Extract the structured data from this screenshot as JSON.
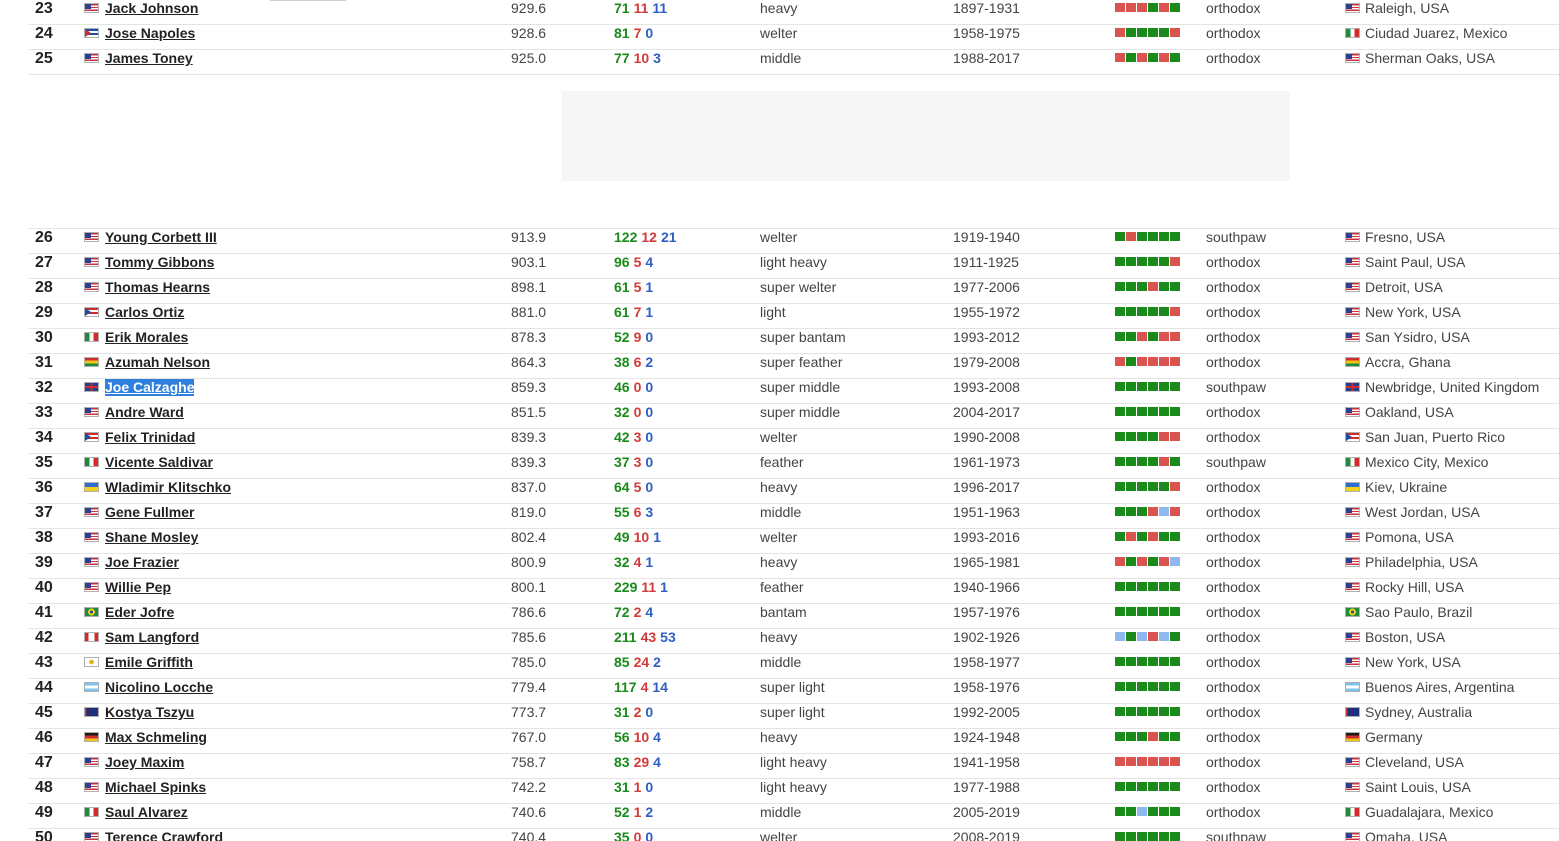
{
  "colors": {
    "win": "#1a8a1a",
    "loss": "#d13b3b",
    "draw": "#2f5fc4",
    "form_win": "#1a8a1a",
    "form_loss": "#d9534f",
    "form_draw": "#8fb8ef"
  },
  "rows_top": [
    {
      "rank": "23",
      "name": "Jack Johnson",
      "flag": "us-flag-icon",
      "rating": "929.6",
      "w": "71",
      "l": "11",
      "d": "11",
      "division": "heavy",
      "years": "1897-1931",
      "form": [
        "L",
        "L",
        "L",
        "W",
        "L",
        "W"
      ],
      "stance": "orthodox",
      "res_flag": "us-flag-icon",
      "residence": "Raleigh, USA"
    },
    {
      "rank": "24",
      "name": "Jose Napoles",
      "flag": "cuba-flag-icon",
      "rating": "928.6",
      "w": "81",
      "l": "7",
      "d": "0",
      "division": "welter",
      "years": "1958-1975",
      "form": [
        "L",
        "W",
        "W",
        "W",
        "W",
        "L"
      ],
      "stance": "orthodox",
      "res_flag": "mexico-flag-icon",
      "residence": "Ciudad Juarez, Mexico"
    },
    {
      "rank": "25",
      "name": "James Toney",
      "flag": "us-flag-icon",
      "rating": "925.0",
      "w": "77",
      "l": "10",
      "d": "3",
      "division": "middle",
      "years": "1988-2017",
      "form": [
        "L",
        "W",
        "L",
        "W",
        "L",
        "W"
      ],
      "stance": "orthodox",
      "res_flag": "us-flag-icon",
      "residence": "Sherman Oaks, USA"
    }
  ],
  "rows_bottom": [
    {
      "rank": "26",
      "name": "Young Corbett III",
      "flag": "us-flag-icon",
      "rating": "913.9",
      "w": "122",
      "l": "12",
      "d": "21",
      "division": "welter",
      "years": "1919-1940",
      "form": [
        "W",
        "L",
        "W",
        "W",
        "W",
        "W"
      ],
      "stance": "southpaw",
      "res_flag": "us-flag-icon",
      "residence": "Fresno, USA"
    },
    {
      "rank": "27",
      "name": "Tommy Gibbons",
      "flag": "us-flag-icon",
      "rating": "903.1",
      "w": "96",
      "l": "5",
      "d": "4",
      "division": "light heavy",
      "years": "1911-1925",
      "form": [
        "W",
        "W",
        "W",
        "W",
        "W",
        "L"
      ],
      "stance": "orthodox",
      "res_flag": "us-flag-icon",
      "residence": "Saint Paul, USA"
    },
    {
      "rank": "28",
      "name": "Thomas Hearns",
      "flag": "us-flag-icon",
      "rating": "898.1",
      "w": "61",
      "l": "5",
      "d": "1",
      "division": "super welter",
      "years": "1977-2006",
      "form": [
        "W",
        "W",
        "W",
        "L",
        "W",
        "W"
      ],
      "stance": "orthodox",
      "res_flag": "us-flag-icon",
      "residence": "Detroit, USA"
    },
    {
      "rank": "29",
      "name": "Carlos Ortiz",
      "flag": "puerto-rico-flag-icon",
      "rating": "881.0",
      "w": "61",
      "l": "7",
      "d": "1",
      "division": "light",
      "years": "1955-1972",
      "form": [
        "W",
        "W",
        "W",
        "W",
        "W",
        "L"
      ],
      "stance": "orthodox",
      "res_flag": "us-flag-icon",
      "residence": "New York, USA"
    },
    {
      "rank": "30",
      "name": "Erik Morales",
      "flag": "mexico-flag-icon",
      "rating": "878.3",
      "w": "52",
      "l": "9",
      "d": "0",
      "division": "super bantam",
      "years": "1993-2012",
      "form": [
        "W",
        "W",
        "L",
        "W",
        "L",
        "L"
      ],
      "stance": "orthodox",
      "res_flag": "us-flag-icon",
      "residence": "San Ysidro, USA"
    },
    {
      "rank": "31",
      "name": "Azumah Nelson",
      "flag": "ghana-flag-icon",
      "rating": "864.3",
      "w": "38",
      "l": "6",
      "d": "2",
      "division": "super feather",
      "years": "1979-2008",
      "form": [
        "L",
        "W",
        "L",
        "L",
        "L",
        "L"
      ],
      "stance": "orthodox",
      "res_flag": "ghana-flag-icon",
      "residence": "Accra, Ghana"
    },
    {
      "rank": "32",
      "name": "Joe Calzaghe",
      "flag": "uk-flag-icon",
      "rating": "859.3",
      "w": "46",
      "l": "0",
      "d": "0",
      "division": "super middle",
      "years": "1993-2008",
      "form": [
        "W",
        "W",
        "W",
        "W",
        "W",
        "W"
      ],
      "stance": "southpaw",
      "res_flag": "uk-flag-icon",
      "residence": "Newbridge, United Kingdom",
      "selected": true
    },
    {
      "rank": "33",
      "name": "Andre Ward",
      "flag": "us-flag-icon",
      "rating": "851.5",
      "w": "32",
      "l": "0",
      "d": "0",
      "division": "super middle",
      "years": "2004-2017",
      "form": [
        "W",
        "W",
        "W",
        "W",
        "W",
        "W"
      ],
      "stance": "orthodox",
      "res_flag": "us-flag-icon",
      "residence": "Oakland, USA"
    },
    {
      "rank": "34",
      "name": "Felix Trinidad",
      "flag": "puerto-rico-flag-icon",
      "rating": "839.3",
      "w": "42",
      "l": "3",
      "d": "0",
      "division": "welter",
      "years": "1990-2008",
      "form": [
        "W",
        "W",
        "W",
        "W",
        "L",
        "L"
      ],
      "stance": "orthodox",
      "res_flag": "puerto-rico-flag-icon",
      "residence": "San Juan, Puerto Rico"
    },
    {
      "rank": "35",
      "name": "Vicente Saldivar",
      "flag": "mexico-flag-icon",
      "rating": "839.3",
      "w": "37",
      "l": "3",
      "d": "0",
      "division": "feather",
      "years": "1961-1973",
      "form": [
        "W",
        "W",
        "W",
        "W",
        "L",
        "W"
      ],
      "stance": "southpaw",
      "res_flag": "mexico-flag-icon",
      "residence": "Mexico City, Mexico"
    },
    {
      "rank": "36",
      "name": "Wladimir Klitschko",
      "flag": "ukraine-flag-icon",
      "rating": "837.0",
      "w": "64",
      "l": "5",
      "d": "0",
      "division": "heavy",
      "years": "1996-2017",
      "form": [
        "W",
        "W",
        "W",
        "W",
        "W",
        "L"
      ],
      "stance": "orthodox",
      "res_flag": "ukraine-flag-icon",
      "residence": "Kiev, Ukraine"
    },
    {
      "rank": "37",
      "name": "Gene Fullmer",
      "flag": "us-flag-icon",
      "rating": "819.0",
      "w": "55",
      "l": "6",
      "d": "3",
      "division": "middle",
      "years": "1951-1963",
      "form": [
        "W",
        "W",
        "W",
        "L",
        "D",
        "L"
      ],
      "stance": "orthodox",
      "res_flag": "us-flag-icon",
      "residence": "West Jordan, USA"
    },
    {
      "rank": "38",
      "name": "Shane Mosley",
      "flag": "us-flag-icon",
      "rating": "802.4",
      "w": "49",
      "l": "10",
      "d": "1",
      "division": "welter",
      "years": "1993-2016",
      "form": [
        "W",
        "L",
        "W",
        "L",
        "W",
        "W"
      ],
      "stance": "orthodox",
      "res_flag": "us-flag-icon",
      "residence": "Pomona, USA"
    },
    {
      "rank": "39",
      "name": "Joe Frazier",
      "flag": "us-flag-icon",
      "rating": "800.9",
      "w": "32",
      "l": "4",
      "d": "1",
      "division": "heavy",
      "years": "1965-1981",
      "form": [
        "L",
        "W",
        "L",
        "W",
        "L",
        "D"
      ],
      "stance": "orthodox",
      "res_flag": "us-flag-icon",
      "residence": "Philadelphia, USA"
    },
    {
      "rank": "40",
      "name": "Willie Pep",
      "flag": "us-flag-icon",
      "rating": "800.1",
      "w": "229",
      "l": "11",
      "d": "1",
      "division": "feather",
      "years": "1940-1966",
      "form": [
        "W",
        "W",
        "W",
        "W",
        "W",
        "W"
      ],
      "stance": "orthodox",
      "res_flag": "us-flag-icon",
      "residence": "Rocky Hill, USA"
    },
    {
      "rank": "41",
      "name": "Eder Jofre",
      "flag": "brazil-flag-icon",
      "rating": "786.6",
      "w": "72",
      "l": "2",
      "d": "4",
      "division": "bantam",
      "years": "1957-1976",
      "form": [
        "W",
        "W",
        "W",
        "W",
        "W",
        "W"
      ],
      "stance": "orthodox",
      "res_flag": "brazil-flag-icon",
      "residence": "Sao Paulo, Brazil"
    },
    {
      "rank": "42",
      "name": "Sam Langford",
      "flag": "canada-flag-icon",
      "rating": "785.6",
      "w": "211",
      "l": "43",
      "d": "53",
      "division": "heavy",
      "years": "1902-1926",
      "form": [
        "D",
        "W",
        "D",
        "L",
        "D",
        "W"
      ],
      "stance": "orthodox",
      "res_flag": "us-flag-icon",
      "residence": "Boston, USA"
    },
    {
      "rank": "43",
      "name": "Emile Griffith",
      "flag": "virgin-islands-flag-icon",
      "rating": "785.0",
      "w": "85",
      "l": "24",
      "d": "2",
      "division": "middle",
      "years": "1958-1977",
      "form": [
        "W",
        "W",
        "W",
        "W",
        "W",
        "W"
      ],
      "stance": "orthodox",
      "res_flag": "us-flag-icon",
      "residence": "New York, USA"
    },
    {
      "rank": "44",
      "name": "Nicolino Locche",
      "flag": "argentina-flag-icon",
      "rating": "779.4",
      "w": "117",
      "l": "4",
      "d": "14",
      "division": "super light",
      "years": "1958-1976",
      "form": [
        "W",
        "W",
        "W",
        "W",
        "W",
        "W"
      ],
      "stance": "orthodox",
      "res_flag": "argentina-flag-icon",
      "residence": "Buenos Aires, Argentina"
    },
    {
      "rank": "45",
      "name": "Kostya Tszyu",
      "flag": "australia-flag-icon",
      "rating": "773.7",
      "w": "31",
      "l": "2",
      "d": "0",
      "division": "super light",
      "years": "1992-2005",
      "form": [
        "W",
        "W",
        "W",
        "W",
        "W",
        "W"
      ],
      "stance": "orthodox",
      "res_flag": "australia-flag-icon",
      "residence": "Sydney, Australia"
    },
    {
      "rank": "46",
      "name": "Max Schmeling",
      "flag": "germany-flag-icon",
      "rating": "767.0",
      "w": "56",
      "l": "10",
      "d": "4",
      "division": "heavy",
      "years": "1924-1948",
      "form": [
        "W",
        "W",
        "W",
        "L",
        "W",
        "W"
      ],
      "stance": "orthodox",
      "res_flag": "germany-flag-icon",
      "residence": "Germany"
    },
    {
      "rank": "47",
      "name": "Joey Maxim",
      "flag": "us-flag-icon",
      "rating": "758.7",
      "w": "83",
      "l": "29",
      "d": "4",
      "division": "light heavy",
      "years": "1941-1958",
      "form": [
        "L",
        "L",
        "L",
        "L",
        "L",
        "L"
      ],
      "stance": "orthodox",
      "res_flag": "us-flag-icon",
      "residence": "Cleveland, USA"
    },
    {
      "rank": "48",
      "name": "Michael Spinks",
      "flag": "us-flag-icon",
      "rating": "742.2",
      "w": "31",
      "l": "1",
      "d": "0",
      "division": "light heavy",
      "years": "1977-1988",
      "form": [
        "W",
        "W",
        "W",
        "W",
        "W",
        "W"
      ],
      "stance": "orthodox",
      "res_flag": "us-flag-icon",
      "residence": "Saint Louis, USA"
    },
    {
      "rank": "49",
      "name": "Saul Alvarez",
      "flag": "mexico-flag-icon",
      "rating": "740.6",
      "w": "52",
      "l": "1",
      "d": "2",
      "division": "middle",
      "years": "2005-2019",
      "form": [
        "W",
        "W",
        "D",
        "W",
        "W",
        "W"
      ],
      "stance": "orthodox",
      "res_flag": "mexico-flag-icon",
      "residence": "Guadalajara, Mexico"
    },
    {
      "rank": "50",
      "name": "Terence Crawford",
      "flag": "us-flag-icon",
      "rating": "740.4",
      "w": "35",
      "l": "0",
      "d": "0",
      "division": "welter",
      "years": "2008-2019",
      "form": [
        "W",
        "W",
        "W",
        "W",
        "W",
        "W"
      ],
      "stance": "southpaw",
      "res_flag": "us-flag-icon",
      "residence": "Omaha, USA"
    }
  ]
}
